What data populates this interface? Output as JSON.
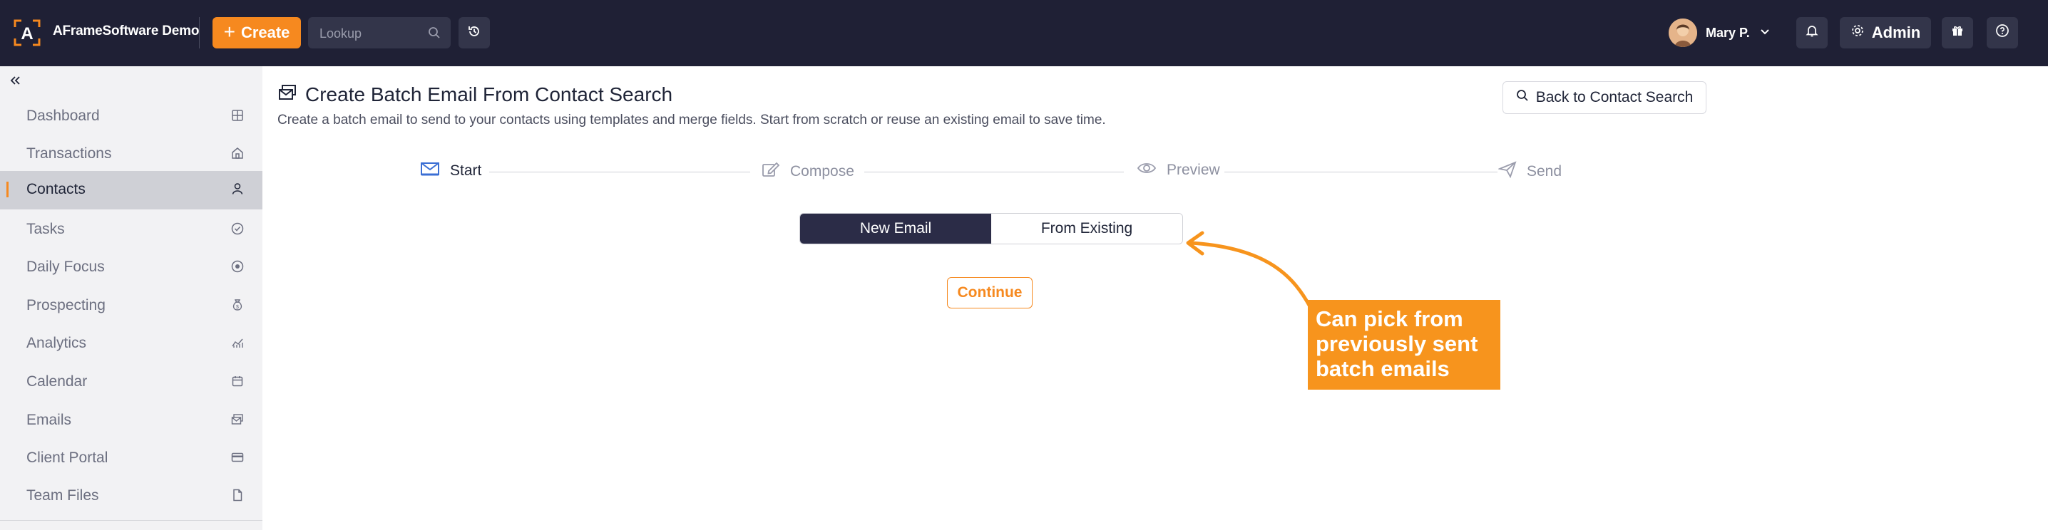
{
  "header": {
    "org_name": "AFrameSoftware Demo",
    "create_label": "Create",
    "lookup_placeholder": "Lookup",
    "user_name": "Mary P.",
    "admin_label": "Admin"
  },
  "sidebar": {
    "items": [
      {
        "label": "Dashboard",
        "icon": "grid-icon"
      },
      {
        "label": "Transactions",
        "icon": "home-icon"
      },
      {
        "label": "Contacts",
        "icon": "person-icon",
        "active": true
      },
      {
        "label": "Tasks",
        "icon": "check-circle-icon"
      },
      {
        "label": "Daily Focus",
        "icon": "target-icon"
      },
      {
        "label": "Prospecting",
        "icon": "money-bag-icon"
      },
      {
        "label": "Analytics",
        "icon": "chart-icon"
      },
      {
        "label": "Calendar",
        "icon": "calendar-icon"
      },
      {
        "label": "Emails",
        "icon": "emails-icon"
      },
      {
        "label": "Client Portal",
        "icon": "card-icon"
      },
      {
        "label": "Team Files",
        "icon": "file-icon"
      }
    ]
  },
  "main": {
    "title": "Create Batch Email From Contact Search",
    "subtitle": "Create a batch email to send to your contacts using templates and merge fields. Start from scratch or reuse an existing email to save time.",
    "back_label": "Back to Contact Search",
    "steps": [
      {
        "label": "Start",
        "state": "active"
      },
      {
        "label": "Compose",
        "state": "inactive"
      },
      {
        "label": "Preview",
        "state": "inactive"
      },
      {
        "label": "Send",
        "state": "inactive"
      }
    ],
    "toggle": {
      "new_label": "New Email",
      "existing_label": "From Existing",
      "selected": "New Email"
    },
    "continue_label": "Continue"
  },
  "annotation": {
    "lines": [
      "Can pick from",
      "previously sent",
      "batch emails"
    ]
  },
  "colors": {
    "topbar": "#1f2035",
    "accent": "#f6891f",
    "callout": "#f7941d",
    "segment_active": "#2b2c47",
    "sidebar_bg": "#f2f2f4",
    "sidebar_active": "#cfd0d6"
  }
}
